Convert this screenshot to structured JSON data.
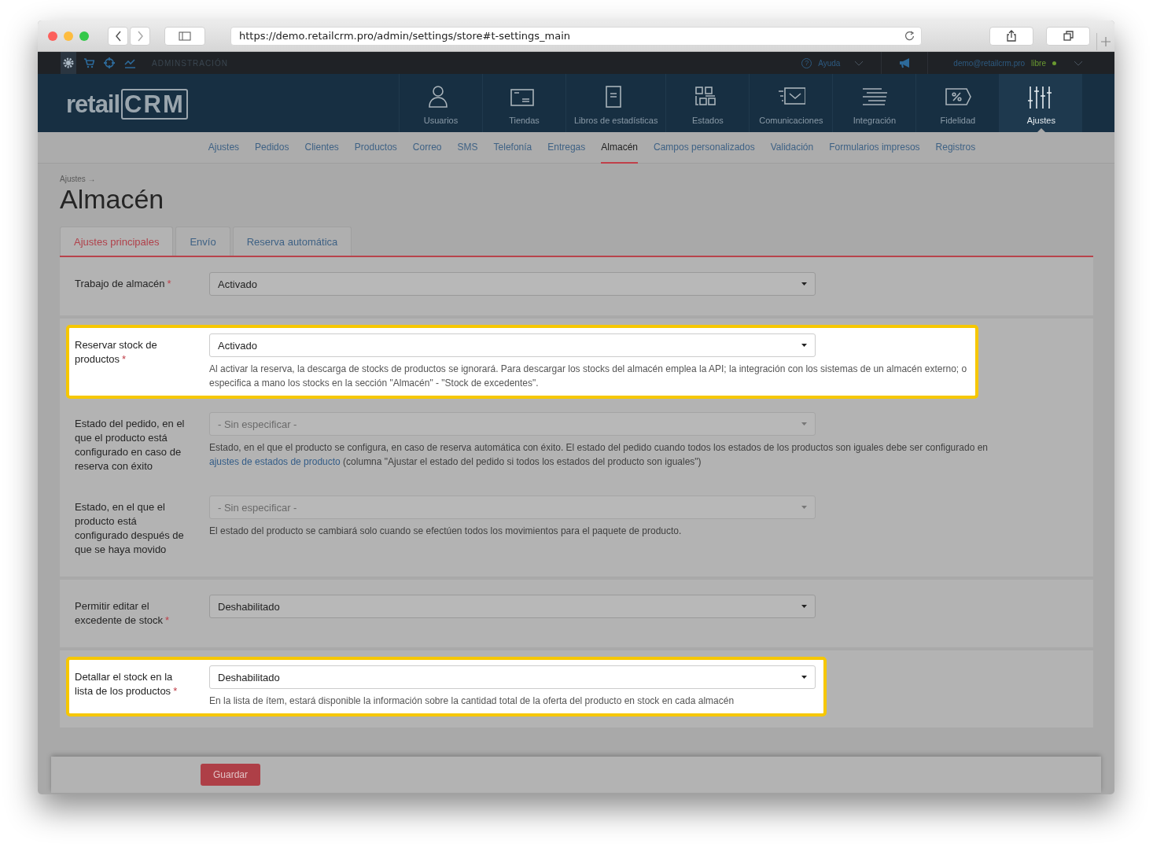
{
  "browser": {
    "url": "https://demo.retailcrm.pro/admin/settings/store#t-settings_main"
  },
  "topbar": {
    "icons": [
      {
        "kind": "gear",
        "selected": true
      },
      {
        "kind": "cart",
        "selected": false
      },
      {
        "kind": "target",
        "selected": false
      },
      {
        "kind": "chart",
        "selected": false
      }
    ],
    "section": "ADMINSTRACIÓN",
    "help_icon": "?",
    "help": "Ayuda",
    "user": "demo@retailcrm.pro",
    "plan": "libre"
  },
  "logo": {
    "text": "retail",
    "mark": "CRM"
  },
  "nav": [
    {
      "label": "Usuarios",
      "kind": "user",
      "selected": false
    },
    {
      "label": "Tiendas",
      "kind": "store",
      "selected": false
    },
    {
      "label": "Libros de estadísticas",
      "kind": "book",
      "selected": false
    },
    {
      "label": "Estados",
      "kind": "states",
      "selected": false
    },
    {
      "label": "Comunicaciones",
      "kind": "mail",
      "selected": false
    },
    {
      "label": "Integración",
      "kind": "lines",
      "selected": false
    },
    {
      "label": "Fidelidad",
      "kind": "percent",
      "selected": false
    },
    {
      "label": "Ajustes",
      "kind": "sliders",
      "selected": true
    }
  ],
  "subnav": [
    {
      "label": "Ajustes",
      "selected": false
    },
    {
      "label": "Pedidos",
      "selected": false
    },
    {
      "label": "Clientes",
      "selected": false
    },
    {
      "label": "Productos",
      "selected": false
    },
    {
      "label": "Correo",
      "selected": false
    },
    {
      "label": "SMS",
      "selected": false
    },
    {
      "label": "Telefonía",
      "selected": false
    },
    {
      "label": "Entregas",
      "selected": false
    },
    {
      "label": "Almacén",
      "selected": true
    },
    {
      "label": "Campos personalizados",
      "selected": false
    },
    {
      "label": "Validación",
      "selected": false
    },
    {
      "label": "Formularios impresos",
      "selected": false
    },
    {
      "label": "Registros",
      "selected": false
    }
  ],
  "breadcrumb": "Ajustes →",
  "title": "Almacén",
  "tabs": [
    {
      "label": "Ajustes principales",
      "selected": true
    },
    {
      "label": "Envío",
      "selected": false
    },
    {
      "label": "Reserva automática",
      "selected": false
    }
  ],
  "sections": [
    {
      "fields": [
        {
          "label": "Trabajo de almacén",
          "required_mark": "*",
          "value": "Activado",
          "highlighted": false
        }
      ]
    },
    {
      "fields": [
        {
          "label": "Reservar stock de productos",
          "required_mark": "*",
          "value": "Activado",
          "highlighted": true,
          "help": [
            "Al activar la reserva, la descarga de stocks de productos se ignorará. Para descargar los stocks del almacén emplea la API; la integración con los sistemas de un almacén externo; o especifica a mano los stocks en la sección \"Almacén\" - \"Stock de excedentes\"."
          ]
        },
        {
          "label": "Estado del pedido, en el que el producto está configurado en caso de reserva con éxito",
          "placeholder": "- Sin especificar -",
          "highlighted": false,
          "help": [
            "Estado, en el que el producto se configura, en caso de reserva automática con éxito. El estado del pedido cuando todos los estados de los productos son iguales debe ser configurado en ",
            "ajustes de estados de producto",
            " (columna \"Ajustar el estado del pedido si todos los estados del producto son iguales\")"
          ]
        },
        {
          "label": "Estado, en el que el producto está configurado después de que se haya movido",
          "placeholder": "- Sin especificar -",
          "highlighted": false,
          "help": [
            "El estado del producto se cambiará solo cuando se efectúen todos los movimientos para el paquete de producto."
          ]
        }
      ]
    },
    {
      "fields": [
        {
          "label": "Permitir editar el excedente de stock",
          "required_mark": "*",
          "value": "Deshabilitado",
          "highlighted": false
        }
      ]
    },
    {
      "fields": [
        {
          "label": "Detallar el stock en la lista de los productos",
          "required_mark": "*",
          "value": "Deshabilitado",
          "highlighted": true,
          "help": [
            "En la lista de ítem, estará disponible la información sobre la cantidad total de la oferta del producto en stock en cada almacén"
          ]
        }
      ]
    }
  ],
  "save": "Guardar"
}
